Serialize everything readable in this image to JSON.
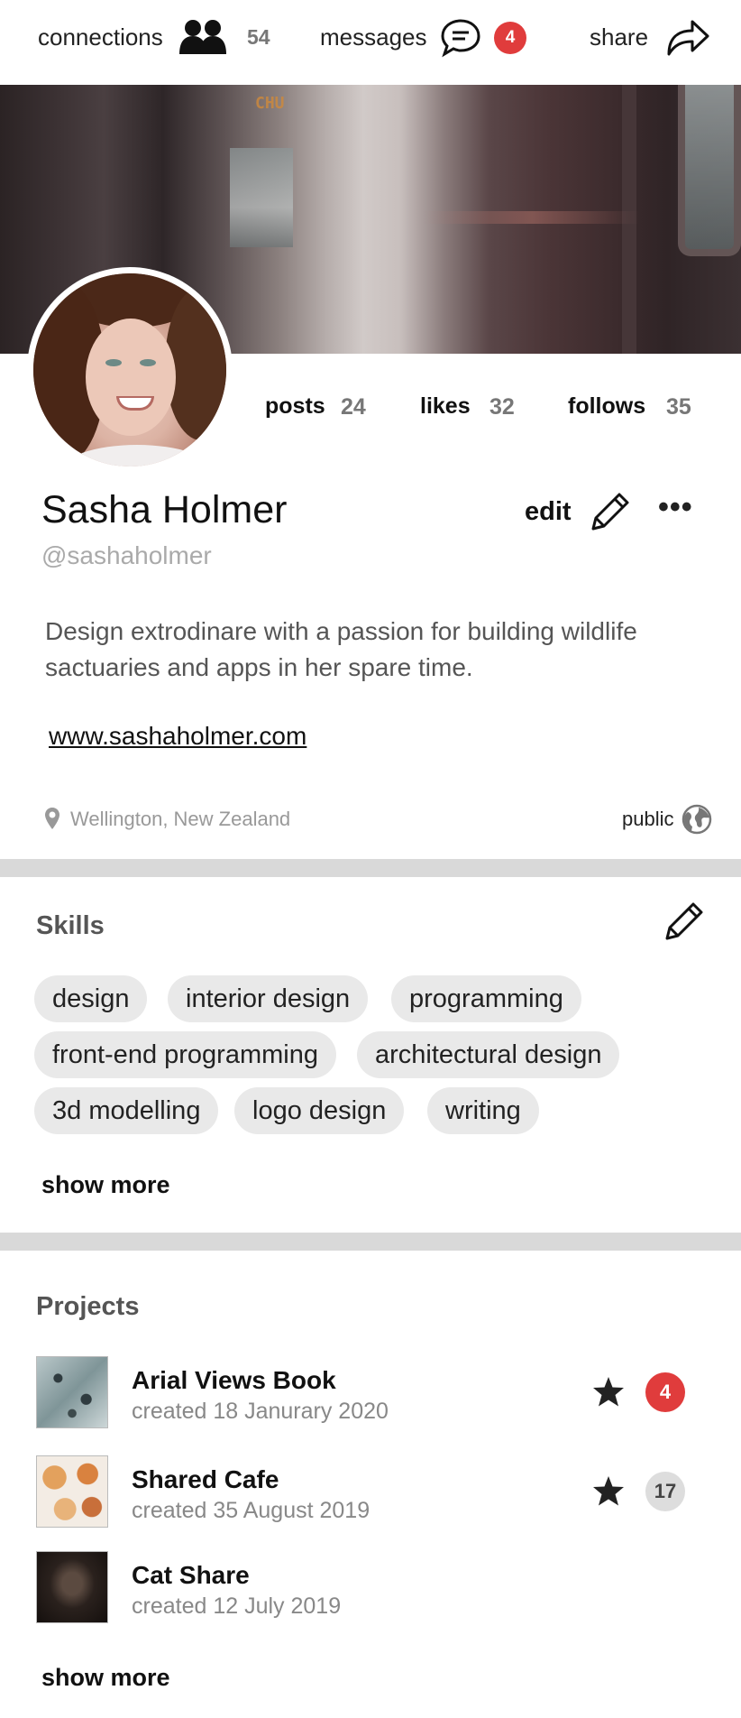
{
  "topbar": {
    "connections_label": "connections",
    "connections_count": "54",
    "messages_label": "messages",
    "messages_count": "4",
    "share_label": "share"
  },
  "profile": {
    "name": "Sasha Holmer",
    "handle": "@sashaholmer",
    "edit_label": "edit",
    "more_label": "•••",
    "bio": "Design extrodinare with a passion for building wildlife sactuaries and apps in her spare time.",
    "website": "www.sashaholmer.com",
    "location": "Wellington, New Zealand",
    "visibility": "public"
  },
  "stats": [
    {
      "label": "posts",
      "value": "24"
    },
    {
      "label": "likes",
      "value": "32"
    },
    {
      "label": "follows",
      "value": "35"
    }
  ],
  "cover": {
    "sign_text": "CHU"
  },
  "skills": {
    "title": "Skills",
    "items": [
      "design",
      "interior design",
      "programming",
      "front-end programming",
      "architectural design",
      "3d modelling",
      "logo design",
      "writing"
    ],
    "show_more": "show more"
  },
  "projects": {
    "title": "Projects",
    "items": [
      {
        "title": "Arial Views Book",
        "date": "created 18 Janurary 2020",
        "starred": true,
        "count": "4",
        "count_color": "#e03c3c"
      },
      {
        "title": "Shared Cafe",
        "date": "created 35 August 2019",
        "starred": true,
        "count": "17",
        "count_color": "#dddddd"
      },
      {
        "title": "Cat Share",
        "date": "created 12 July 2019",
        "starred": false,
        "count": ""
      }
    ],
    "show_more": "show more"
  },
  "colors": {
    "accent_red": "#e03c3c",
    "divider": "#d9d9d9",
    "chip": "#e9e9e9"
  },
  "icons": [
    "people-icon",
    "chat-icon",
    "share-arrow-icon",
    "pencil-icon",
    "location-pin-icon",
    "globe-icon",
    "star-icon"
  ]
}
